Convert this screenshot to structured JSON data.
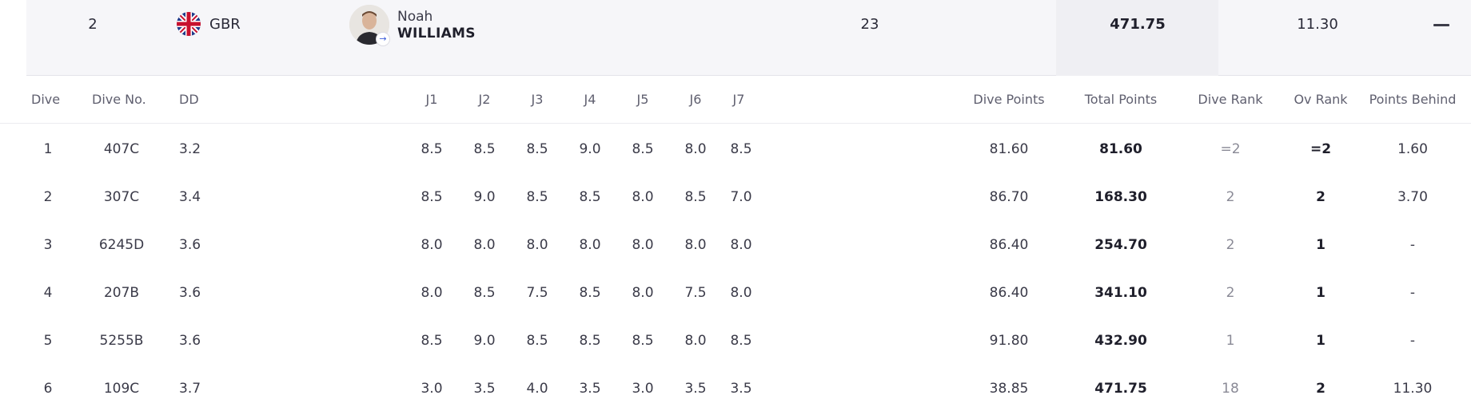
{
  "athlete": {
    "rank": "2",
    "country": "GBR",
    "given_name": "Noah",
    "family_name": "WILLIAMS",
    "age": "23",
    "total_points": "471.75",
    "points_behind": "11.30",
    "collapse_icon": "minus-icon",
    "flag_icon": "union-jack-flag-icon"
  },
  "table": {
    "headers": {
      "dive": "Dive",
      "dive_no": "Dive No.",
      "dd": "DD",
      "j1": "J1",
      "j2": "J2",
      "j3": "J3",
      "j4": "J4",
      "j5": "J5",
      "j6": "J6",
      "j7": "J7",
      "dive_points": "Dive Points",
      "total_points": "Total Points",
      "dive_rank": "Dive Rank",
      "ov_rank": "Ov Rank",
      "points_behind": "Points Behind"
    },
    "rows": [
      {
        "dive": "1",
        "dive_no": "407C",
        "dd": "3.2",
        "j1": "8.5",
        "j2": "8.5",
        "j3": "8.5",
        "j4": "9.0",
        "j5": "8.5",
        "j6": "8.0",
        "j7": "8.5",
        "dive_points": "81.60",
        "total_points": "81.60",
        "dive_rank": "=2",
        "ov_rank": "=2",
        "points_behind": "1.60"
      },
      {
        "dive": "2",
        "dive_no": "307C",
        "dd": "3.4",
        "j1": "8.5",
        "j2": "9.0",
        "j3": "8.5",
        "j4": "8.5",
        "j5": "8.0",
        "j6": "8.5",
        "j7": "7.0",
        "dive_points": "86.70",
        "total_points": "168.30",
        "dive_rank": "2",
        "ov_rank": "2",
        "points_behind": "3.70"
      },
      {
        "dive": "3",
        "dive_no": "6245D",
        "dd": "3.6",
        "j1": "8.0",
        "j2": "8.0",
        "j3": "8.0",
        "j4": "8.0",
        "j5": "8.0",
        "j6": "8.0",
        "j7": "8.0",
        "dive_points": "86.40",
        "total_points": "254.70",
        "dive_rank": "2",
        "ov_rank": "1",
        "points_behind": "-"
      },
      {
        "dive": "4",
        "dive_no": "207B",
        "dd": "3.6",
        "j1": "8.0",
        "j2": "8.5",
        "j3": "7.5",
        "j4": "8.5",
        "j5": "8.0",
        "j6": "7.5",
        "j7": "8.0",
        "dive_points": "86.40",
        "total_points": "341.10",
        "dive_rank": "2",
        "ov_rank": "1",
        "points_behind": "-"
      },
      {
        "dive": "5",
        "dive_no": "5255B",
        "dd": "3.6",
        "j1": "8.5",
        "j2": "9.0",
        "j3": "8.5",
        "j4": "8.5",
        "j5": "8.5",
        "j6": "8.0",
        "j7": "8.5",
        "dive_points": "91.80",
        "total_points": "432.90",
        "dive_rank": "1",
        "ov_rank": "1",
        "points_behind": "-"
      },
      {
        "dive": "6",
        "dive_no": "109C",
        "dd": "3.7",
        "j1": "3.0",
        "j2": "3.5",
        "j3": "4.0",
        "j4": "3.5",
        "j5": "3.0",
        "j6": "3.5",
        "j7": "3.5",
        "dive_points": "38.85",
        "total_points": "471.75",
        "dive_rank": "18",
        "ov_rank": "2",
        "points_behind": "11.30"
      }
    ]
  }
}
